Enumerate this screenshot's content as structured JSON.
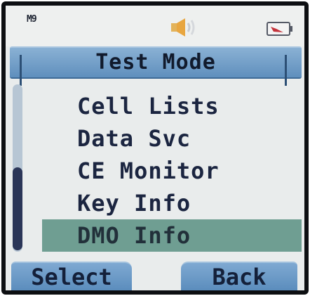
{
  "status": {
    "signal_label": "M9",
    "icons": [
      "signal-icon",
      "speaker-icon",
      "battery-icon"
    ]
  },
  "header": {
    "title": "Test Mode"
  },
  "menu": {
    "items": [
      {
        "label": "Cell Lists"
      },
      {
        "label": "Data Svc"
      },
      {
        "label": "CE Monitor"
      },
      {
        "label": "Key Info"
      },
      {
        "label": "DMO Info"
      }
    ],
    "selected_index": 4
  },
  "softkeys": {
    "left": "Select",
    "right": "Back"
  },
  "colors": {
    "title_bar": "#6f9cc6",
    "selection": "#6f9e92",
    "screen_bg": "#e9ecec",
    "text": "#1b2540",
    "scroll_thumb": "#2b3658"
  }
}
